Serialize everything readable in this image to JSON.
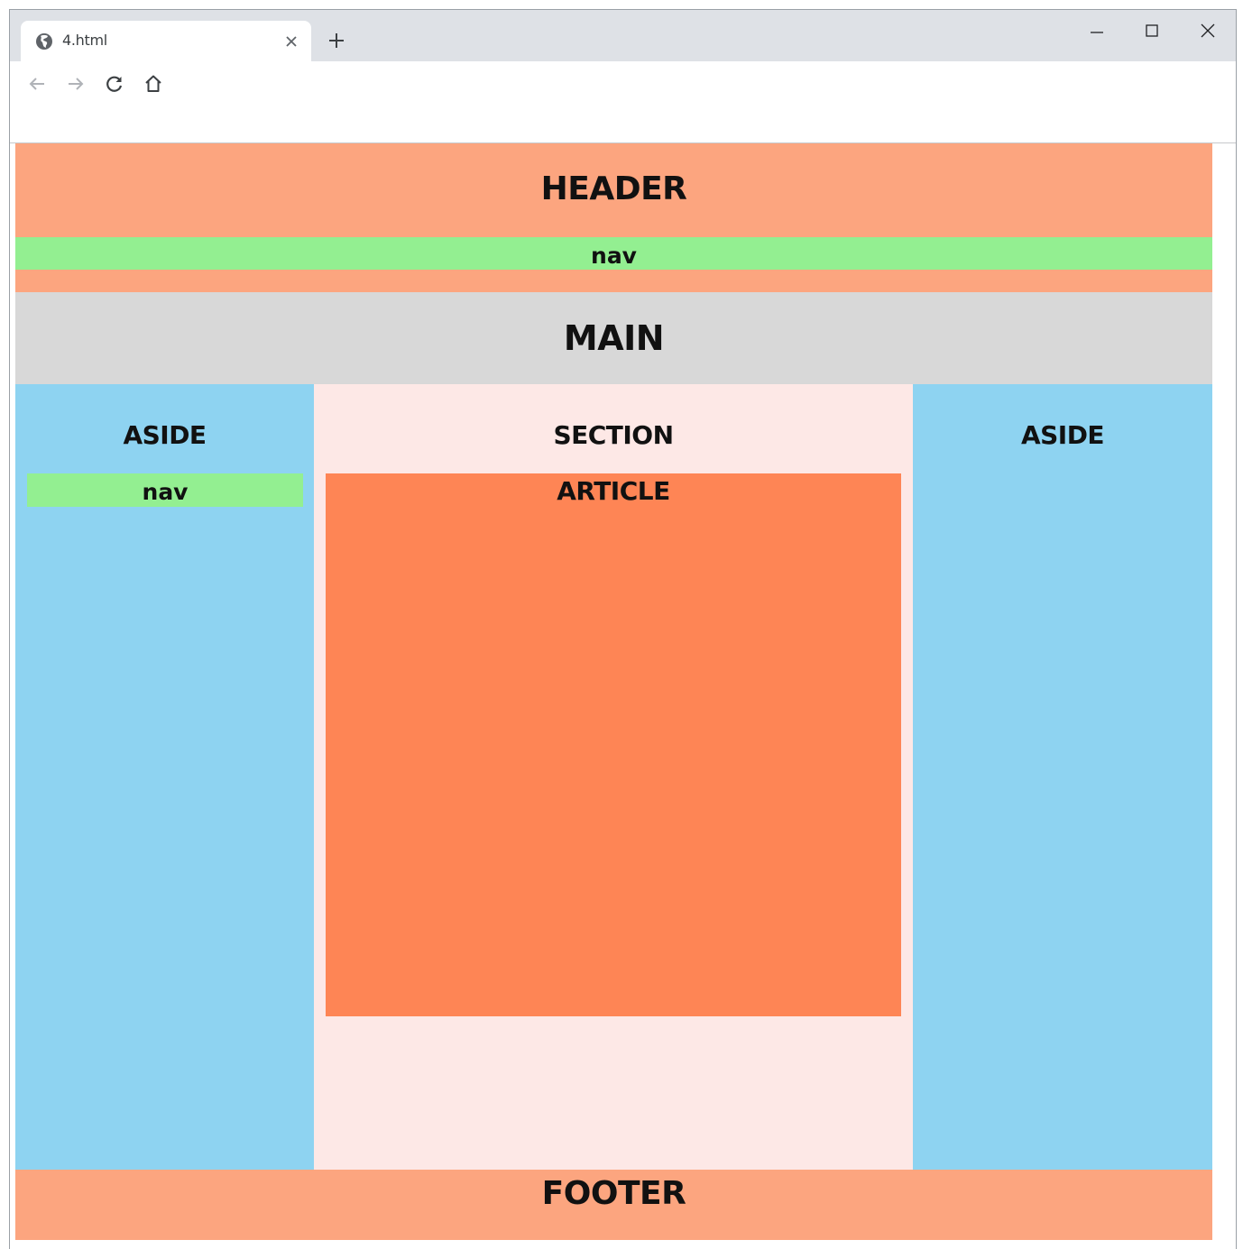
{
  "browser": {
    "tab": {
      "title": "4.html",
      "favicon": "globe-icon",
      "close_icon": "close-icon"
    },
    "new_tab_icon": "plus-icon",
    "window_controls": [
      "minimize-icon",
      "maximize-icon",
      "close-icon"
    ],
    "toolbar": [
      "back-arrow-icon",
      "forward-arrow-icon",
      "reload-icon",
      "home-icon"
    ]
  },
  "page": {
    "header": "HEADER",
    "header_nav": "nav",
    "main": "MAIN",
    "aside_left": "ASIDE",
    "aside_left_nav": "nav",
    "section": "SECTION",
    "article": "ARTICLE",
    "aside_right": "ASIDE",
    "footer": "FOOTER"
  },
  "colors": {
    "header": "#fca57f",
    "nav": "#93ef91",
    "main": "#d8d8d8",
    "aside": "#8ed3f1",
    "section": "#fde8e6",
    "article": "#fe8555",
    "footer": "#fca57f",
    "tabstrip": "#dee1e6"
  }
}
